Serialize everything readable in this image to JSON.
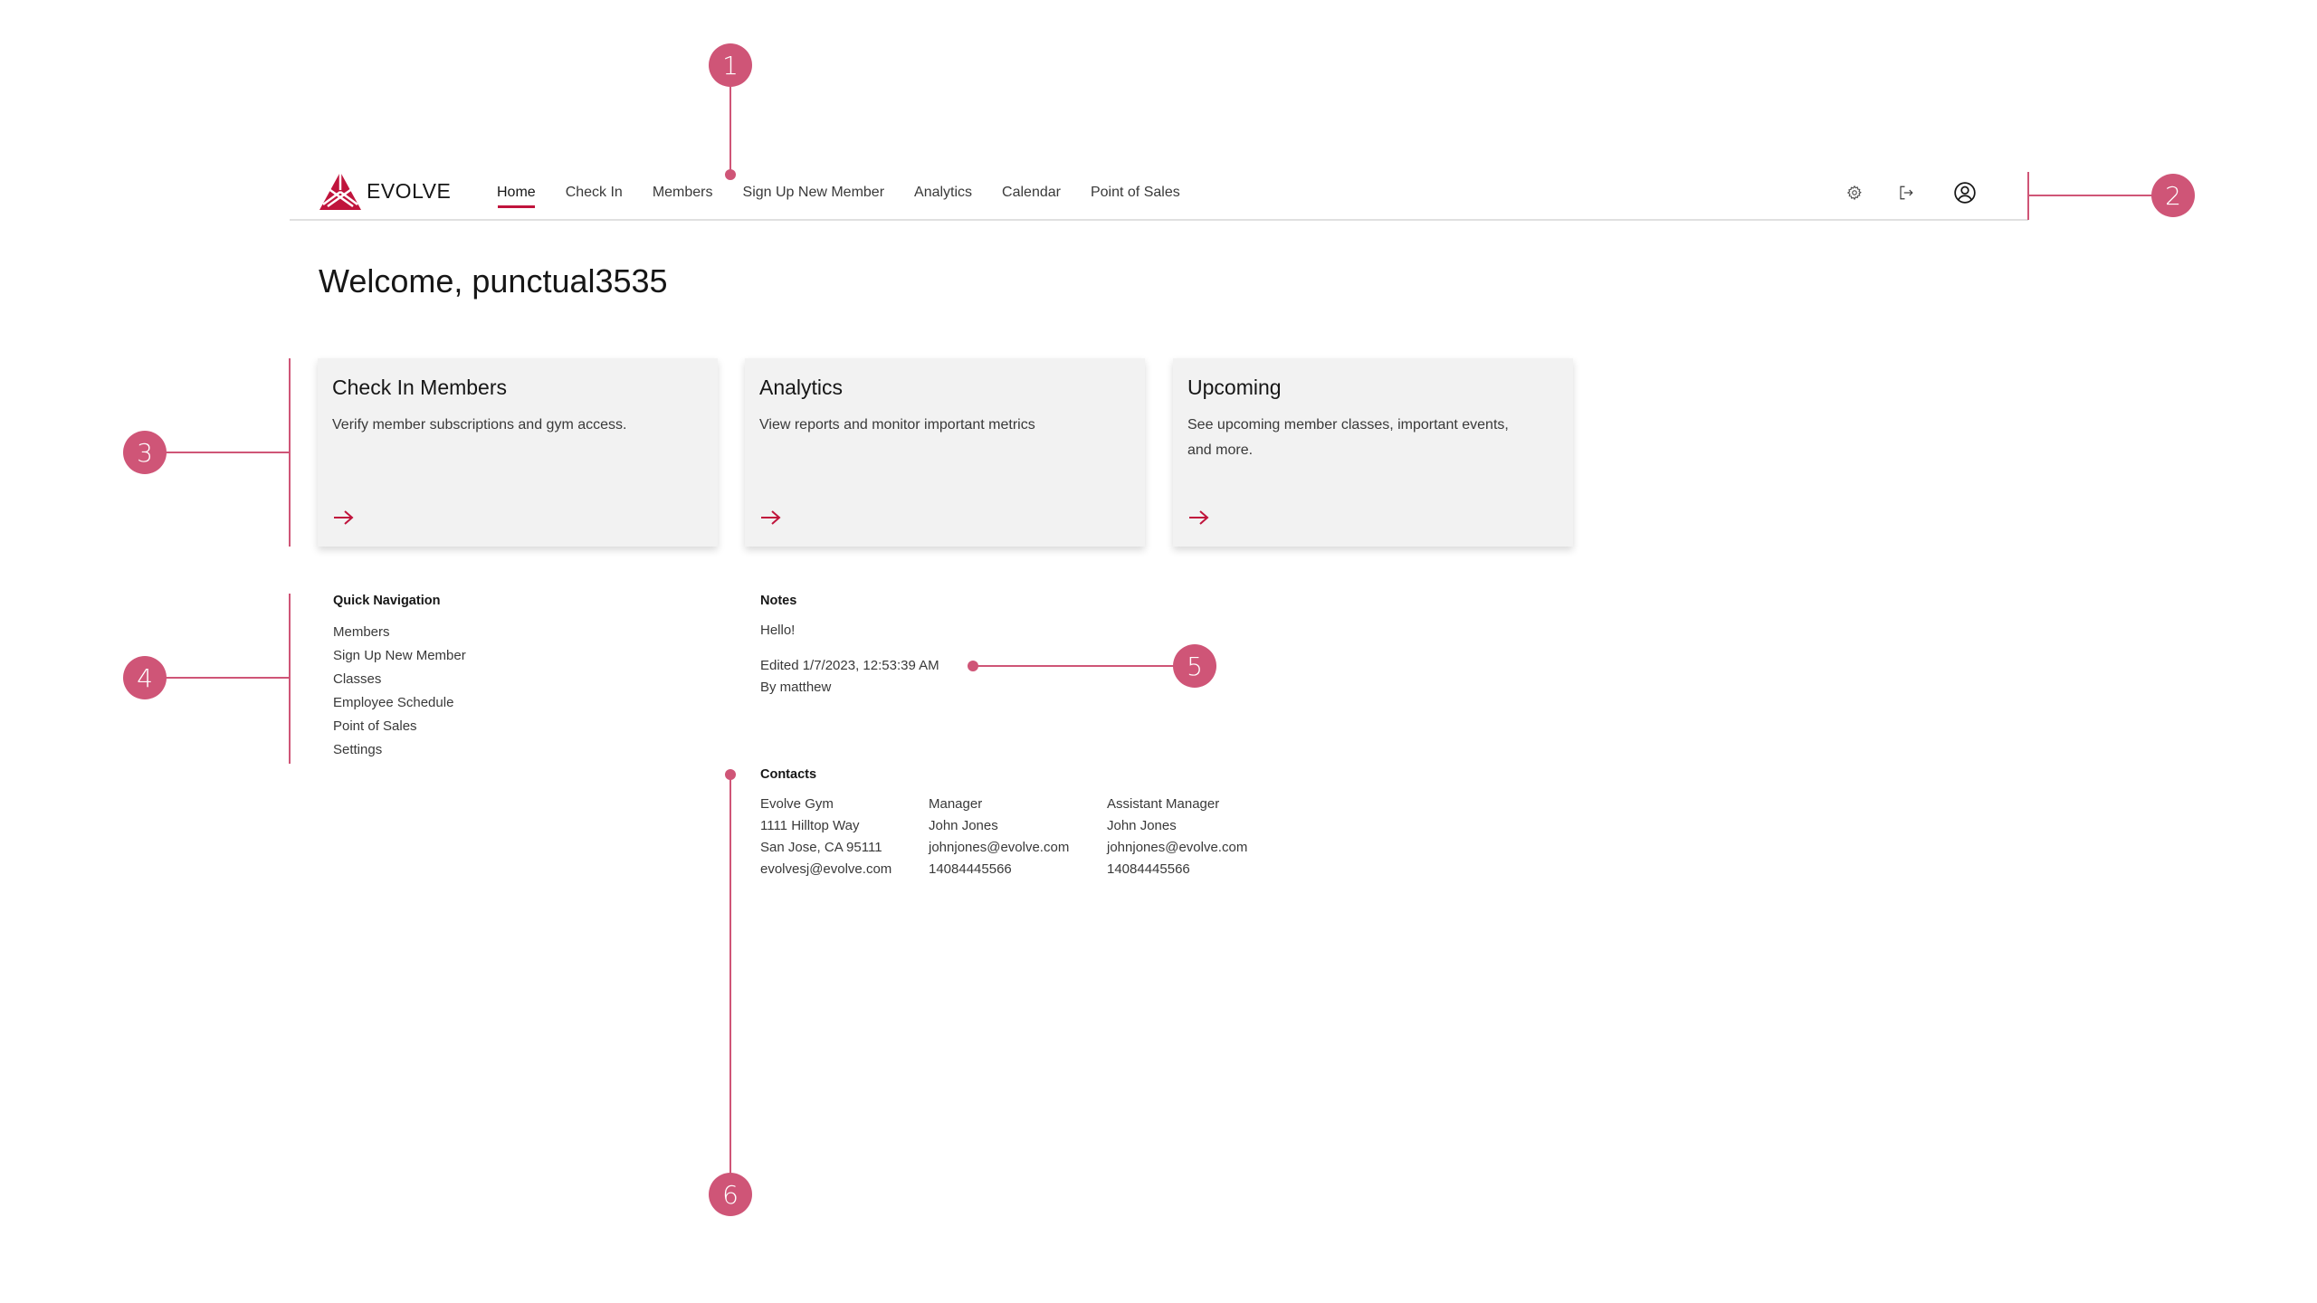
{
  "brand": {
    "name": "EVOLVE",
    "accent_color": "#c0143c",
    "annotation_color": "#cf5577"
  },
  "header": {
    "nav": [
      {
        "label": "Home",
        "active": true
      },
      {
        "label": "Check In",
        "active": false
      },
      {
        "label": "Members",
        "active": false
      },
      {
        "label": "Sign Up New Member",
        "active": false
      },
      {
        "label": "Analytics",
        "active": false
      },
      {
        "label": "Calendar",
        "active": false
      },
      {
        "label": "Point of Sales",
        "active": false
      }
    ],
    "icons": [
      "settings-icon",
      "logout-icon",
      "user-profile-icon"
    ]
  },
  "welcome": "Welcome, punctual3535",
  "cards": [
    {
      "title": "Check In Members",
      "description": "Verify member subscriptions and gym access.",
      "icon": "arrow-right-icon"
    },
    {
      "title": "Analytics",
      "description": "View reports and monitor important metrics",
      "icon": "arrow-right-icon"
    },
    {
      "title": "Upcoming",
      "description": "See upcoming member classes, important events, and more.",
      "icon": "arrow-right-icon"
    }
  ],
  "quick_navigation": {
    "title": "Quick Navigation",
    "items": [
      "Members",
      "Sign Up New Member",
      "Classes",
      "Employee Schedule",
      "Point of Sales",
      "Settings"
    ]
  },
  "notes": {
    "title": "Notes",
    "content": "Hello!",
    "edited": "Edited 1/7/2023, 12:53:39 AM",
    "author": "By matthew"
  },
  "contacts": {
    "title": "Contacts",
    "columns": [
      [
        "Evolve Gym",
        "1111 Hilltop Way",
        "San Jose, CA 95111",
        "evolvesj@evolve.com"
      ],
      [
        "Manager",
        "John Jones",
        "johnjones@evolve.com",
        "14084445566"
      ],
      [
        "Assistant Manager",
        "John Jones",
        "johnjones@evolve.com",
        "14084445566"
      ]
    ]
  },
  "annotations": [
    "1",
    "2",
    "3",
    "4",
    "5",
    "6"
  ]
}
